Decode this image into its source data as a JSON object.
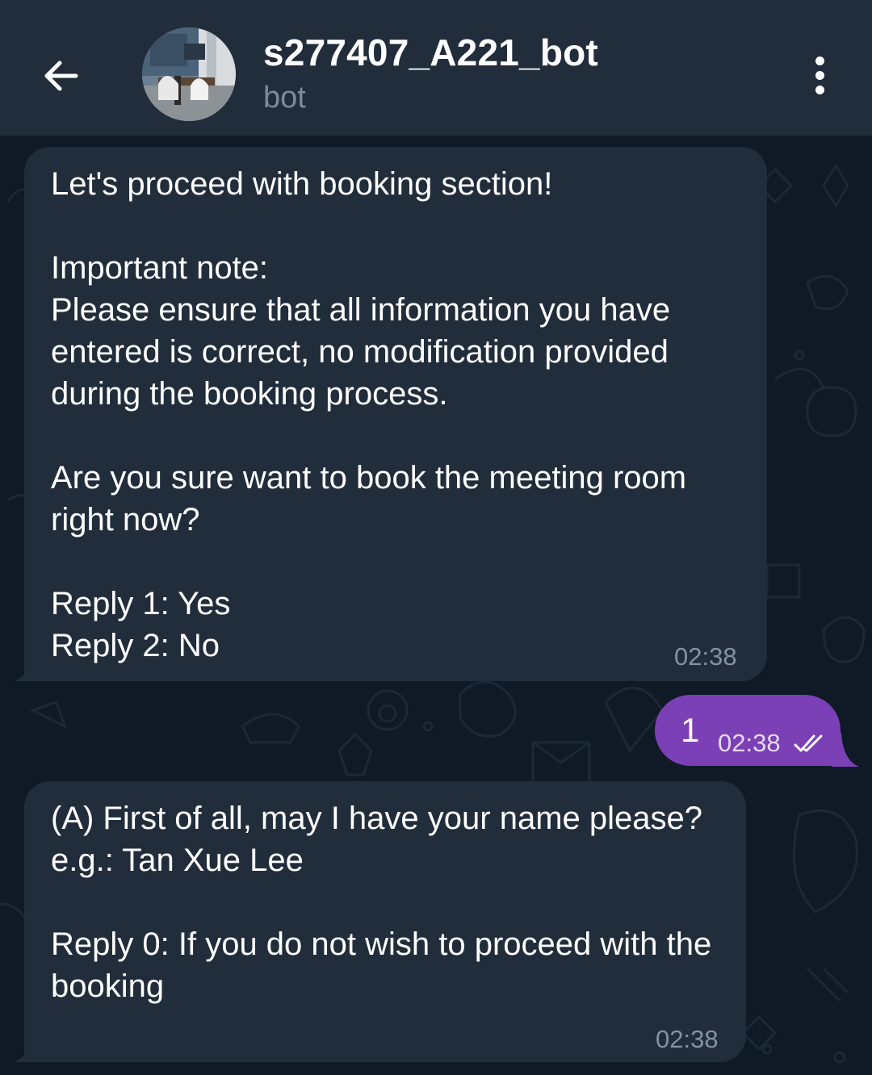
{
  "header": {
    "title": "s277407_A221_bot",
    "subtitle": "bot"
  },
  "messages": [
    {
      "direction": "incoming",
      "text": "Let's proceed with booking section!\n\nImportant note:\nPlease ensure that all information you have entered is correct, no modification provided during the booking process.\n\nAre you sure want to book the meeting room right now?\n\nReply 1: Yes\nReply 2: No",
      "time": "02:38"
    },
    {
      "direction": "outgoing",
      "text": "1",
      "time": "02:38",
      "status": "read"
    },
    {
      "direction": "incoming",
      "text": "(A) First of all, may I have your name please?\ne.g.: Tan Xue Lee\n\nReply 0: If you do not wish to proceed with the booking",
      "time": "02:38"
    }
  ],
  "icons": {
    "back": "arrow-left-icon",
    "menu": "vertical-dots-icon",
    "read_status": "double-check-icon"
  },
  "colors": {
    "header_bg": "#212d3b",
    "chat_bg": "#0e1621",
    "incoming_bubble": "#212d3b",
    "outgoing_bubble": "#7b40b5",
    "time_text": "#8393a3",
    "subtitle_text": "#7d8b99"
  }
}
